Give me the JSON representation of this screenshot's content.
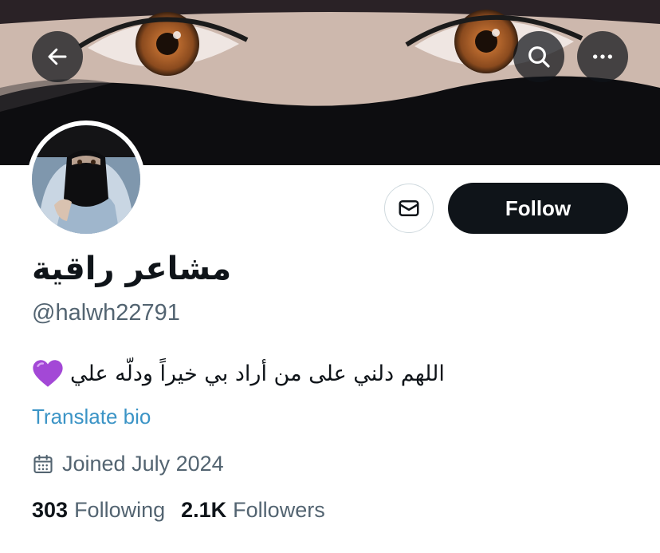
{
  "header": {
    "back_icon": "arrow-left-icon",
    "search_icon": "search-icon",
    "more_icon": "more-horizontal-icon"
  },
  "profile": {
    "display_name": "مشاعر راقية",
    "handle": "@halwh22791",
    "bio": "اللهم دلني على من أراد بي خيراً ودلّه علي",
    "bio_emoji": "purple-heart-icon",
    "translate_label": "Translate bio",
    "joined": "Joined July 2024",
    "following_count": "303",
    "following_label": "Following",
    "followers_count": "2.1K",
    "followers_label": "Followers"
  },
  "actions": {
    "message_icon": "mail-icon",
    "follow_label": "Follow"
  },
  "colors": {
    "accent": "#1d9bf0",
    "link": "#3b94c6",
    "text_primary": "#0f1419",
    "text_secondary": "#536471",
    "button_dark": "#0f1419"
  }
}
